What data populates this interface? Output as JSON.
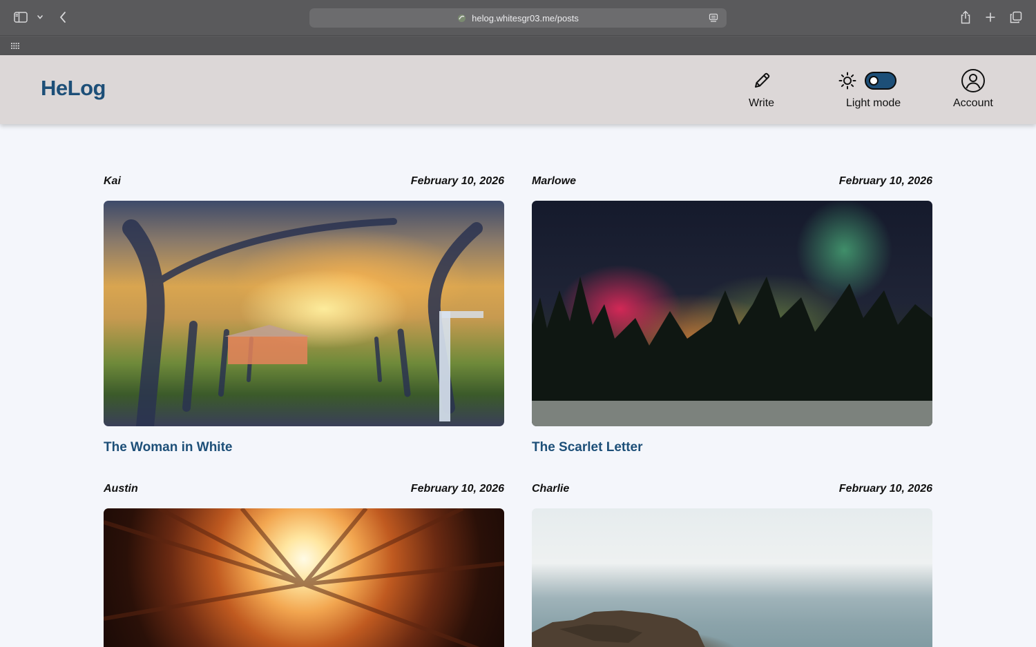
{
  "browser": {
    "url": "helog.whitesgr03.me/posts"
  },
  "app": {
    "logo": "HeLog",
    "nav": {
      "write_label": "Write",
      "theme_label": "Light mode",
      "account_label": "Account"
    },
    "theme_toggle_on": true,
    "colors": {
      "brand": "#1d4f78",
      "header_bg": "#dcd7d7",
      "page_bg": "#f4f6fb"
    }
  },
  "posts": [
    {
      "author": "Kai",
      "date": "February 10, 2026",
      "title": "The Woman in White",
      "image": "orchard-sunset"
    },
    {
      "author": "Marlowe",
      "date": "February 10, 2026",
      "title": "The Scarlet Letter",
      "image": "aurora-forest"
    },
    {
      "author": "Austin",
      "date": "February 10, 2026",
      "title": "",
      "image": "light-tunnel"
    },
    {
      "author": "Charlie",
      "date": "February 10, 2026",
      "title": "",
      "image": "rocky-sea"
    }
  ]
}
